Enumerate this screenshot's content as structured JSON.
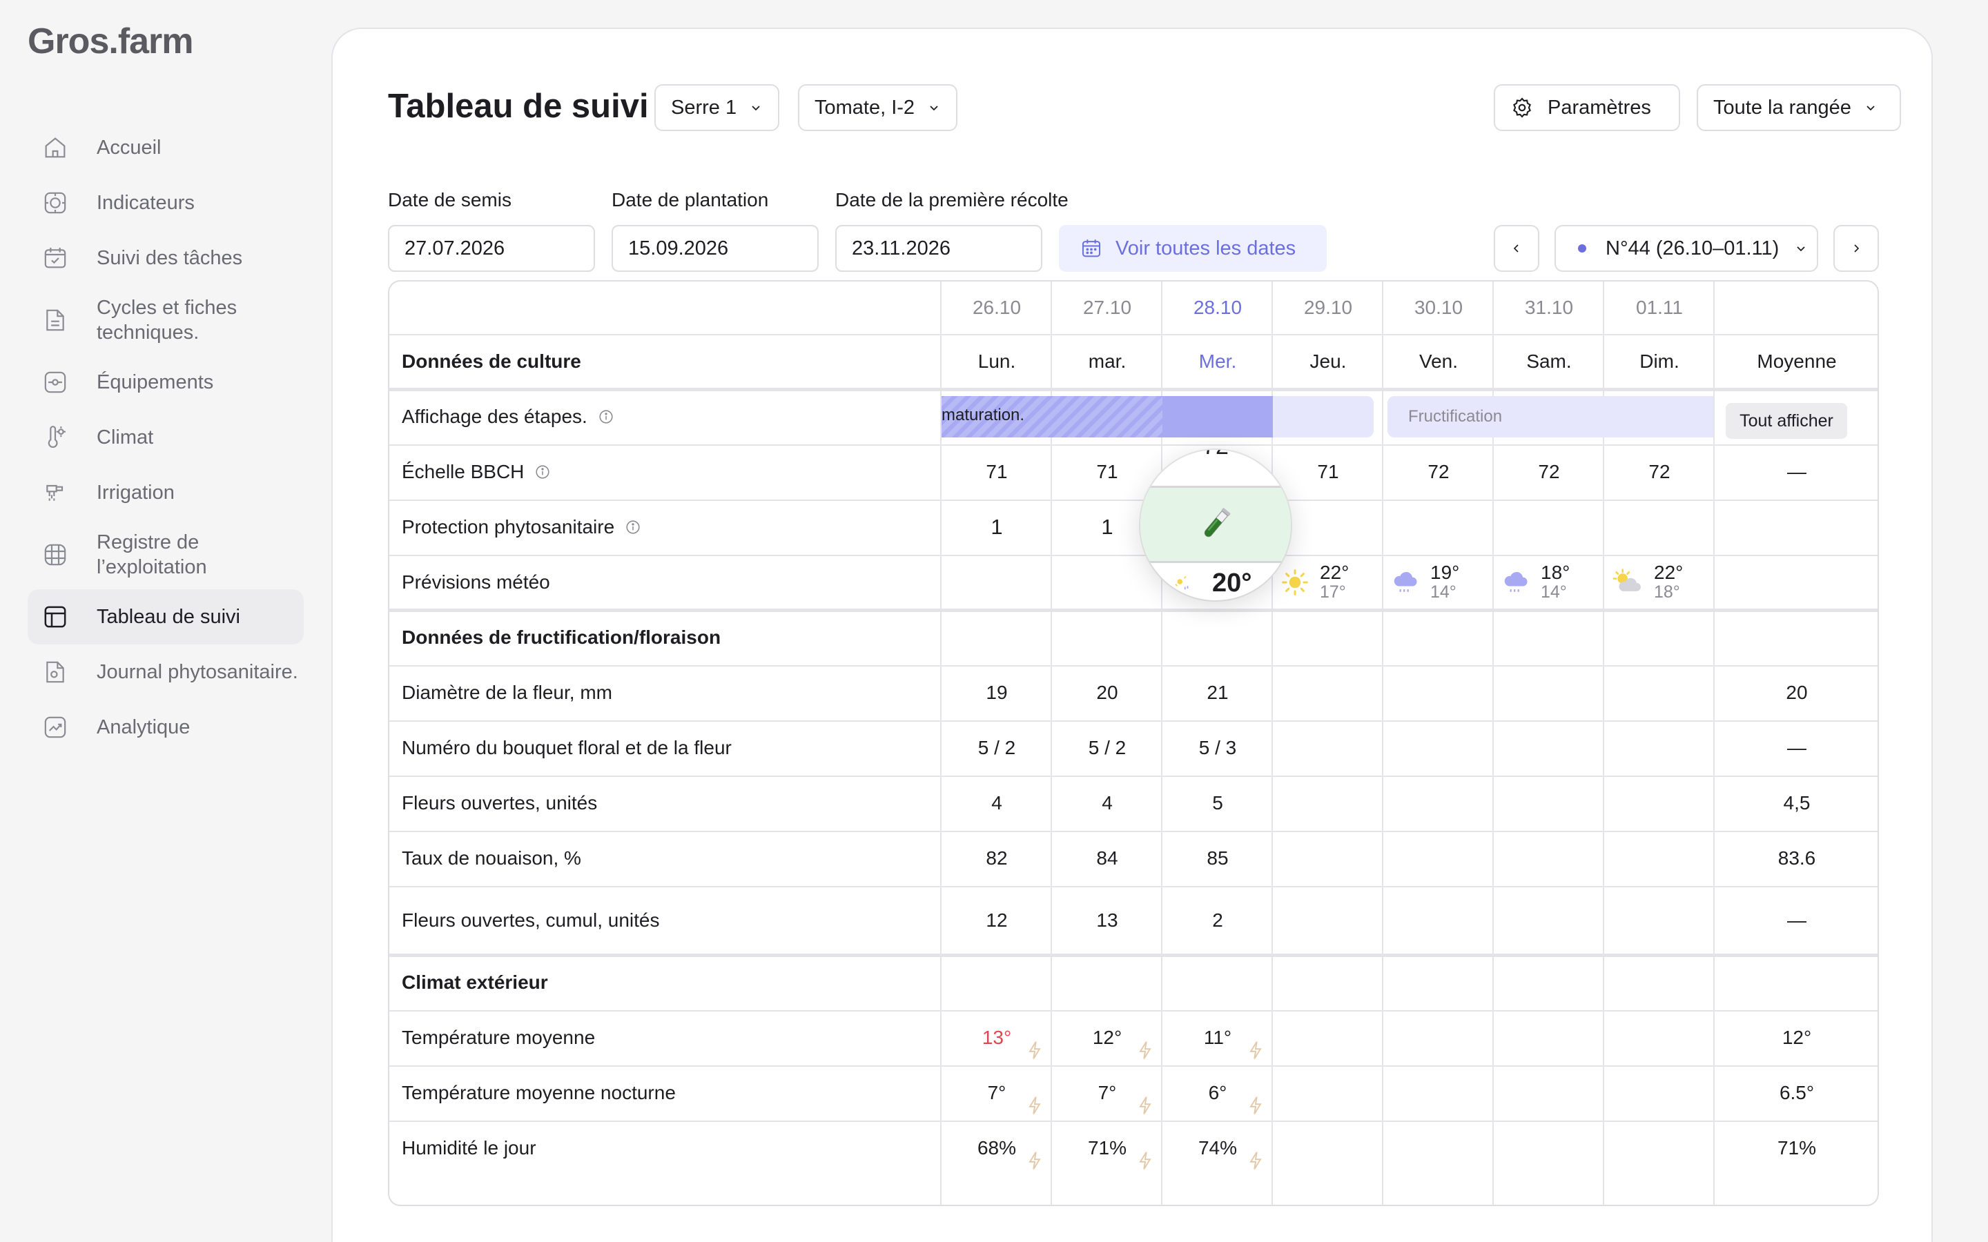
{
  "app": {
    "logo": "Gros.farm"
  },
  "sidebar": {
    "items": [
      {
        "label": "Accueil",
        "icon": "home-icon"
      },
      {
        "label": "Indicateurs",
        "icon": "target-icon"
      },
      {
        "label": "Suivi des tâches",
        "icon": "calendar-check-icon"
      },
      {
        "label": "Cycles et fiches techniques.",
        "icon": "document-icon"
      },
      {
        "label": "Équipements",
        "icon": "equipment-icon"
      },
      {
        "label": "Climat",
        "icon": "thermometer-icon"
      },
      {
        "label": "Irrigation",
        "icon": "irrigation-icon"
      },
      {
        "label": "Registre de l’exploitation",
        "icon": "grid-icon"
      },
      {
        "label": "Tableau de suivi",
        "icon": "table-icon",
        "active": true
      },
      {
        "label": "Journal phytosanitaire.",
        "icon": "journal-icon"
      },
      {
        "label": "Analytique",
        "icon": "chart-icon"
      }
    ]
  },
  "header": {
    "title": "Tableau de suivi",
    "greenhouse": "Serre 1",
    "crop": "Tomate, I-2",
    "settings_label": "Paramètres",
    "scope": "Toute la rangée"
  },
  "dates": {
    "sowing_label": "Date de semis",
    "sowing_value": "27.07.2026",
    "planting_label": "Date de plantation",
    "planting_value": "15.09.2026",
    "harvest_label": "Date de la première récolte",
    "harvest_value": "23.11.2026",
    "see_all_label": "Voir toutes les dates",
    "week_label": "N°44 (26.10–01.11)"
  },
  "table": {
    "dates": [
      "26.10",
      "27.10",
      "28.10",
      "29.10",
      "30.10",
      "31.10",
      "01.11"
    ],
    "days": [
      "Lun.",
      "mar.",
      "Mer.",
      "Jeu.",
      "Ven.",
      "Sam.",
      "Dim."
    ],
    "today_index": 2,
    "average_label": "Moyenne",
    "section_crop": "Données de culture",
    "stages_label": "Affichage des étapes.",
    "stage_maturation": "maturation.",
    "stage_fructification": "Fructification",
    "show_all_label": "Tout afficher",
    "bbch_label": "Échelle BBCH",
    "bbch": [
      "71",
      "71",
      "72",
      "71",
      "72",
      "72",
      "72"
    ],
    "bbch_avg": "—",
    "protection_label": "Protection phytosanitaire",
    "protection": [
      "1",
      "1"
    ],
    "weather_label": "Prévisions météo",
    "weather": [
      {
        "hi": "20°",
        "lo": "",
        "icon": "sun-rain-icon"
      },
      {
        "hi": "22°",
        "lo": "17°",
        "icon": "sun-icon"
      },
      {
        "hi": "19°",
        "lo": "14°",
        "icon": "rain-cloud-icon"
      },
      {
        "hi": "18°",
        "lo": "14°",
        "icon": "rain-cloud-icon"
      },
      {
        "hi": "22°",
        "lo": "18°",
        "icon": "sun-cloud-icon"
      }
    ],
    "section_fruit": "Données de fructification/floraison",
    "fruit_rows": [
      {
        "label": "Diamètre de la fleur, mm",
        "values": [
          "19",
          "20",
          "21"
        ],
        "avg": "20"
      },
      {
        "label": "Numéro du bouquet floral et de la fleur",
        "values": [
          "5 / 2",
          "5 / 2",
          "5 / 3"
        ],
        "avg": "—"
      },
      {
        "label": "Fleurs ouvertes, unités",
        "values": [
          "4",
          "4",
          "5"
        ],
        "avg": "4,5"
      },
      {
        "label": "Taux de nouaison, %",
        "values": [
          "82",
          "84",
          "85"
        ],
        "avg": "83.6"
      },
      {
        "label": "Fleurs ouvertes, cumul, unités",
        "values": [
          "12",
          "13",
          "2"
        ],
        "avg": "—"
      }
    ],
    "section_climate": "Climat extérieur",
    "climate_rows": [
      {
        "label": "Température moyenne",
        "values": [
          "13°",
          "12°",
          "11°"
        ],
        "avg": "12°"
      },
      {
        "label": "Température moyenne nocturne",
        "values": [
          "7°",
          "7°",
          "6°"
        ],
        "avg": "6.5°"
      },
      {
        "label": "Humidité le jour",
        "values": [
          "68%",
          "71%",
          "74%"
        ],
        "avg": "71%"
      }
    ],
    "magnifier_peek_value": "72"
  },
  "colors": {
    "accent": "#6b6fde",
    "stage_dark": "#a7a9f3",
    "stage_light": "#e6e6fd",
    "alert": "#e0474c",
    "bolt": "#e3c9a8"
  }
}
